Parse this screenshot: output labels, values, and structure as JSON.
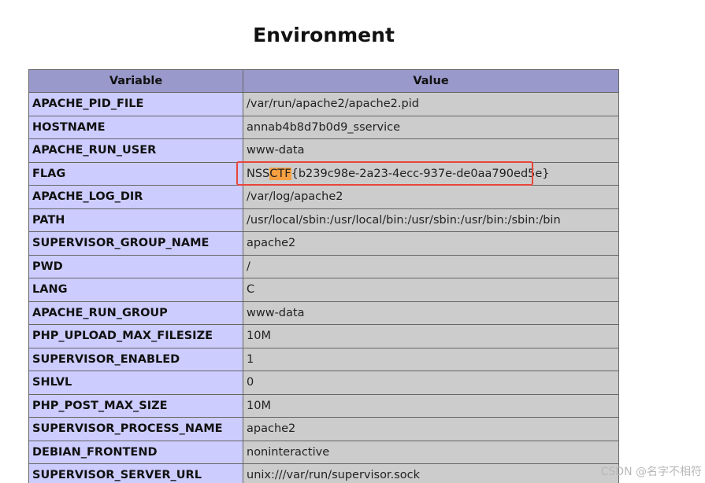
{
  "page": {
    "title": "Environment",
    "watermark": "CSDN @名字不相符"
  },
  "table": {
    "headers": [
      "Variable",
      "Value"
    ],
    "rows": [
      {
        "variable": "APACHE_PID_FILE",
        "value": "/var/run/apache2/apache2.pid"
      },
      {
        "variable": "HOSTNAME",
        "value": "annab4b8d7b0d9_sservice"
      },
      {
        "variable": "APACHE_RUN_USER",
        "value": "www-data"
      },
      {
        "variable": "FLAG",
        "value": "NSSCTF{b239c98e-2a23-4ecc-937e-de0aa790ed5e}",
        "value_parts": [
          "NSS",
          "CTF",
          "{b239c98e-2a23-4ecc-937e-de0aa790ed5e}"
        ]
      },
      {
        "variable": "APACHE_LOG_DIR",
        "value": "/var/log/apache2"
      },
      {
        "variable": "PATH",
        "value": "/usr/local/sbin:/usr/local/bin:/usr/sbin:/usr/bin:/sbin:/bin"
      },
      {
        "variable": "SUPERVISOR_GROUP_NAME",
        "value": "apache2"
      },
      {
        "variable": "PWD",
        "value": "/"
      },
      {
        "variable": "LANG",
        "value": "C"
      },
      {
        "variable": "APACHE_RUN_GROUP",
        "value": "www-data"
      },
      {
        "variable": "PHP_UPLOAD_MAX_FILESIZE",
        "value": "10M"
      },
      {
        "variable": "SUPERVISOR_ENABLED",
        "value": "1"
      },
      {
        "variable": "SHLVL",
        "value": "0"
      },
      {
        "variable": "PHP_POST_MAX_SIZE",
        "value": "10M"
      },
      {
        "variable": "SUPERVISOR_PROCESS_NAME",
        "value": "apache2"
      },
      {
        "variable": "DEBIAN_FRONTEND",
        "value": "noninteractive"
      },
      {
        "variable": "SUPERVISOR_SERVER_URL",
        "value": "unix:///var/run/supervisor.sock"
      }
    ]
  },
  "colors": {
    "header_bg": "#9999cc",
    "variable_bg": "#ccccff",
    "value_bg": "#cccccc",
    "highlight": "#f6a040",
    "annotation_box": "#e8453c"
  }
}
